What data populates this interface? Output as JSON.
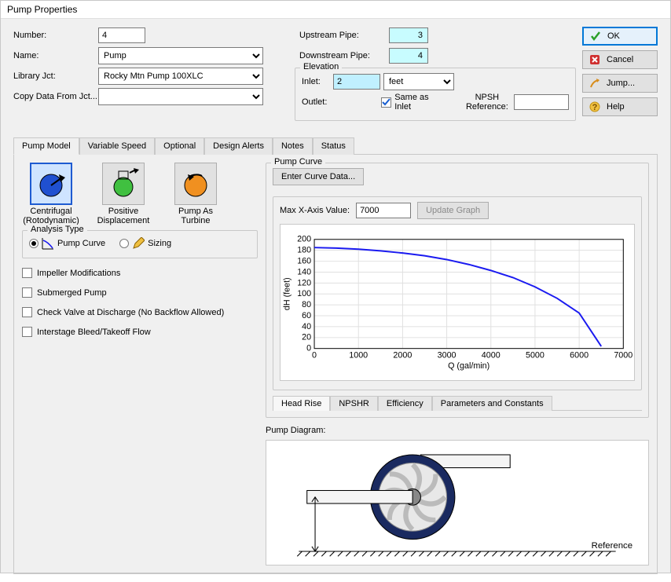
{
  "window": {
    "title": "Pump Properties"
  },
  "form": {
    "number_label": "Number:",
    "number_value": "4",
    "name_label": "Name:",
    "name_value": "Pump",
    "library_label": "Library Jct:",
    "library_value": "Rocky Mtn Pump 100XLC",
    "copy_label": "Copy Data From Jct...",
    "copy_value": "",
    "upstream_label": "Upstream Pipe:",
    "upstream_value": "3",
    "downstream_label": "Downstream Pipe:",
    "downstream_value": "4",
    "elevation_legend": "Elevation",
    "inlet_label": "Inlet:",
    "inlet_value": "2",
    "inlet_unit": "feet",
    "outlet_label": "Outlet:",
    "same_as_inlet_label": "Same as Inlet",
    "npsh_label": "NPSH Reference:"
  },
  "buttons": {
    "ok": "OK",
    "cancel": "Cancel",
    "jump": "Jump...",
    "help": "Help"
  },
  "tabs": {
    "items": [
      {
        "label": "Pump Model",
        "active": true
      },
      {
        "label": "Variable Speed",
        "active": false
      },
      {
        "label": "Optional",
        "active": false
      },
      {
        "label": "Design Alerts",
        "active": false
      },
      {
        "label": "Notes",
        "active": false
      },
      {
        "label": "Status",
        "active": false
      }
    ]
  },
  "models": {
    "centrifugal": "Centrifugal\n(Rotodynamic)",
    "positive": "Positive\nDisplacement",
    "turbine": "Pump As\nTurbine"
  },
  "analysis": {
    "legend": "Analysis Type",
    "pump_curve_label": "Pump Curve",
    "sizing_label": "Sizing"
  },
  "checks": {
    "impeller": "Impeller Modifications",
    "submerged": "Submerged Pump",
    "check_valve": "Check Valve at Discharge (No Backflow Allowed)",
    "interstage": "Interstage Bleed/Takeoff Flow"
  },
  "curve": {
    "legend": "Pump Curve",
    "enter_btn": "Enter Curve Data...",
    "maxx_label": "Max X-Axis Value:",
    "maxx_value": "7000",
    "update_btn": "Update Graph",
    "subtabs": [
      {
        "label": "Head Rise",
        "active": true
      },
      {
        "label": "NPSHR",
        "active": false
      },
      {
        "label": "Efficiency",
        "active": false
      },
      {
        "label": "Parameters and Constants",
        "active": false
      }
    ]
  },
  "chart_data": {
    "type": "line",
    "xlabel": "Q (gal/min)",
    "ylabel": "dH (feet)",
    "xlim": [
      0,
      7000
    ],
    "ylim": [
      0,
      200
    ],
    "xticks": [
      0,
      1000,
      2000,
      3000,
      4000,
      5000,
      6000,
      7000
    ],
    "yticks": [
      0,
      20,
      40,
      60,
      80,
      100,
      120,
      140,
      160,
      180,
      200
    ],
    "series": [
      {
        "name": "Pump Curve",
        "color": "#1a1af0",
        "x": [
          0,
          500,
          1000,
          1500,
          2000,
          2500,
          3000,
          3500,
          4000,
          4500,
          5000,
          5500,
          6000,
          6500
        ],
        "y": [
          185,
          184,
          182,
          179,
          175,
          170,
          163,
          154,
          143,
          130,
          113,
          92,
          65,
          4
        ]
      }
    ]
  },
  "diagram": {
    "label": "Pump Diagram:",
    "reference_label": "Reference"
  }
}
